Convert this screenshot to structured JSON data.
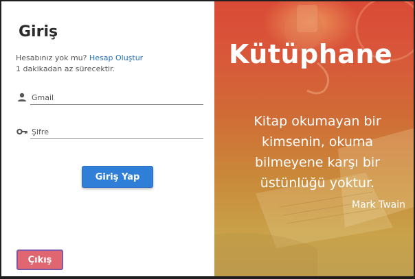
{
  "login": {
    "title": "Giriş",
    "no_account_text": "Hesabınız yok mu?",
    "create_account_link": "Hesap Oluştur",
    "hint": "1 dakikadan az sürecektir.",
    "gmail_placeholder": "Gmail",
    "password_placeholder": "Şifre",
    "login_button": "Giriş Yap",
    "exit_button": "Çıkış"
  },
  "banner": {
    "brand": "Kütüphane",
    "quote": "Kitap okumayan bir kimsenin, okuma bilmeyene karşı bir üstünlüğü yoktur.",
    "author": "Mark Twain"
  },
  "colors": {
    "primary_button": "#2f7fd8",
    "exit_button": "#e06672",
    "link": "#1f6fb8"
  },
  "icons": {
    "gmail_field": "person-icon",
    "password_field": "key-icon"
  }
}
